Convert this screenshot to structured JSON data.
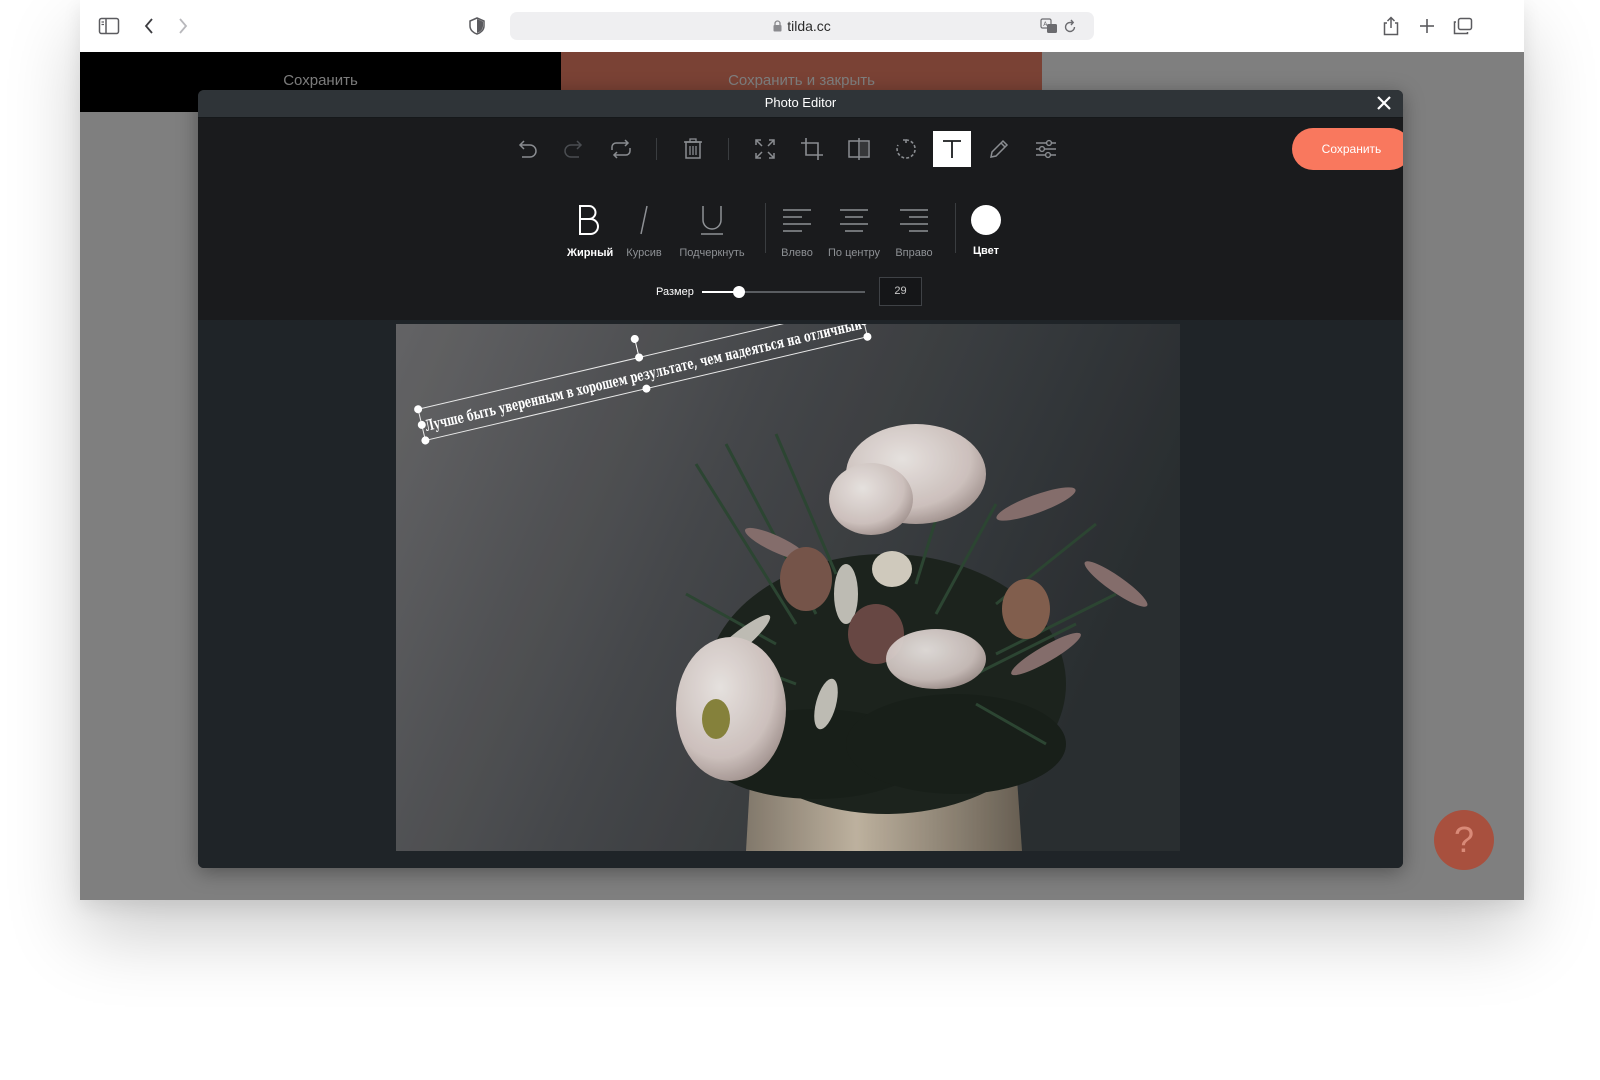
{
  "browser": {
    "url": "tilda.cc"
  },
  "page": {
    "save_label": "Сохранить",
    "save_close_label": "Сохранить и закрыть",
    "help_label": "?"
  },
  "editor": {
    "title": "Photo Editor",
    "save_label": "Сохранить",
    "active_tool": "text",
    "tools": [
      "undo",
      "redo",
      "reset",
      "delete",
      "fullscreen",
      "crop",
      "flip",
      "rotate",
      "text",
      "draw",
      "filters"
    ],
    "format": {
      "bold": "Жирный",
      "italic": "Курсив",
      "underline": "Подчеркнуть",
      "align_left": "Влево",
      "align_center": "По центру",
      "align_right": "Вправо",
      "color": "Цвет",
      "active_style": "bold",
      "text_color": "#ffffff"
    },
    "size": {
      "label": "Размер",
      "value": "29",
      "fraction": 0.23
    },
    "overlay_text": "Лучше быть уверенным в хорошем результате, чем надеяться на отличный"
  },
  "colors": {
    "accent": "#f9785e",
    "modal_bg": "#1e2226",
    "toolbar_bg": "#1a1b1d"
  }
}
